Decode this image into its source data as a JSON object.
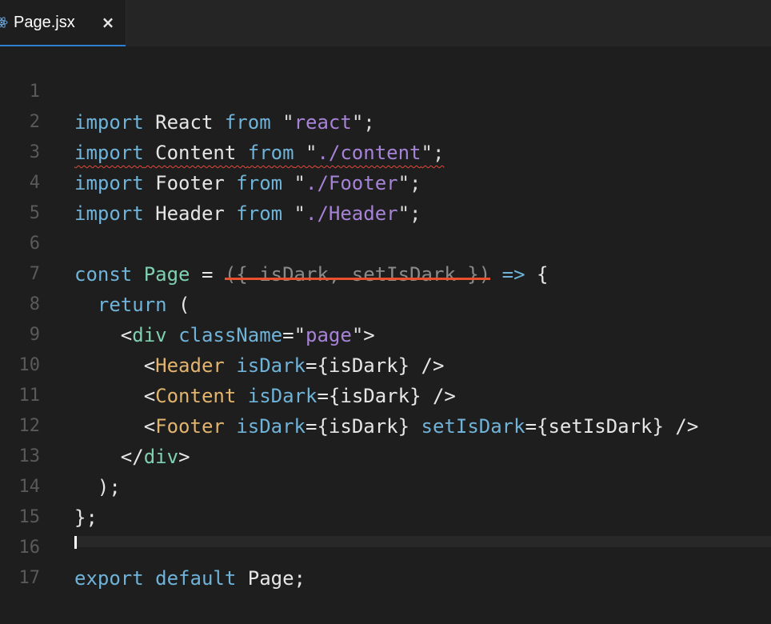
{
  "tab": {
    "icon": "react-icon",
    "label": "Page.jsx",
    "close_icon": "close-icon",
    "close_glyph": "×"
  },
  "lines": {
    "1": {
      "num": "1",
      "t": [
        "import",
        " React ",
        "from",
        " \"",
        "react",
        "\";"
      ]
    },
    "2": {
      "num": "2",
      "t": [
        "import",
        " Content ",
        "from",
        " \"",
        "./content",
        "\";"
      ]
    },
    "3": {
      "num": "3",
      "t": [
        "import",
        " Footer ",
        "from",
        " \"",
        "./Footer",
        "\";"
      ]
    },
    "4": {
      "num": "4",
      "t": [
        "import",
        " Header ",
        "from",
        " \"",
        "./Header",
        "\";"
      ]
    },
    "5": {
      "num": "5"
    },
    "6": {
      "num": "6",
      "t": [
        "const",
        " ",
        "Page",
        " = ",
        "({ isDark, setIsDark })",
        " ",
        "=>",
        " {"
      ]
    },
    "7": {
      "num": "7",
      "t": [
        "  ",
        "return",
        " ("
      ]
    },
    "8": {
      "num": "8",
      "t": [
        "    <",
        "div",
        " ",
        "className",
        "=",
        "\"",
        "page",
        "\"",
        ">"
      ]
    },
    "9": {
      "num": "9",
      "t": [
        "      <",
        "Header",
        " ",
        "isDark",
        "=",
        "{isDark}",
        " />"
      ]
    },
    "10": {
      "num": "10",
      "t": [
        "      <",
        "Content",
        " ",
        "isDark",
        "=",
        "{isDark}",
        " />"
      ]
    },
    "11": {
      "num": "11",
      "t": [
        "      <",
        "Footer",
        " ",
        "isDark",
        "=",
        "{isDark}",
        " ",
        "setIsDark",
        "=",
        "{setIsDark}",
        " />"
      ]
    },
    "12": {
      "num": "12",
      "t": [
        "    </",
        "div",
        ">"
      ]
    },
    "13": {
      "num": "13",
      "t": [
        "  );"
      ]
    },
    "14": {
      "num": "14",
      "t": [
        "};"
      ]
    },
    "15": {
      "num": "15"
    },
    "16": {
      "num": "16",
      "t": [
        "export",
        " ",
        "default",
        " Page;"
      ]
    },
    "17": {
      "num": "17"
    }
  },
  "colors": {
    "background": "#1e1e1e",
    "keyword": "#6fb3d8",
    "string_path": "#a783d8",
    "component": "#e2b46d",
    "tag": "#7fd0b0",
    "error_squiggle": "#e24a3a",
    "strike": "#e8502e",
    "tab_accent": "#2f7fd3"
  }
}
